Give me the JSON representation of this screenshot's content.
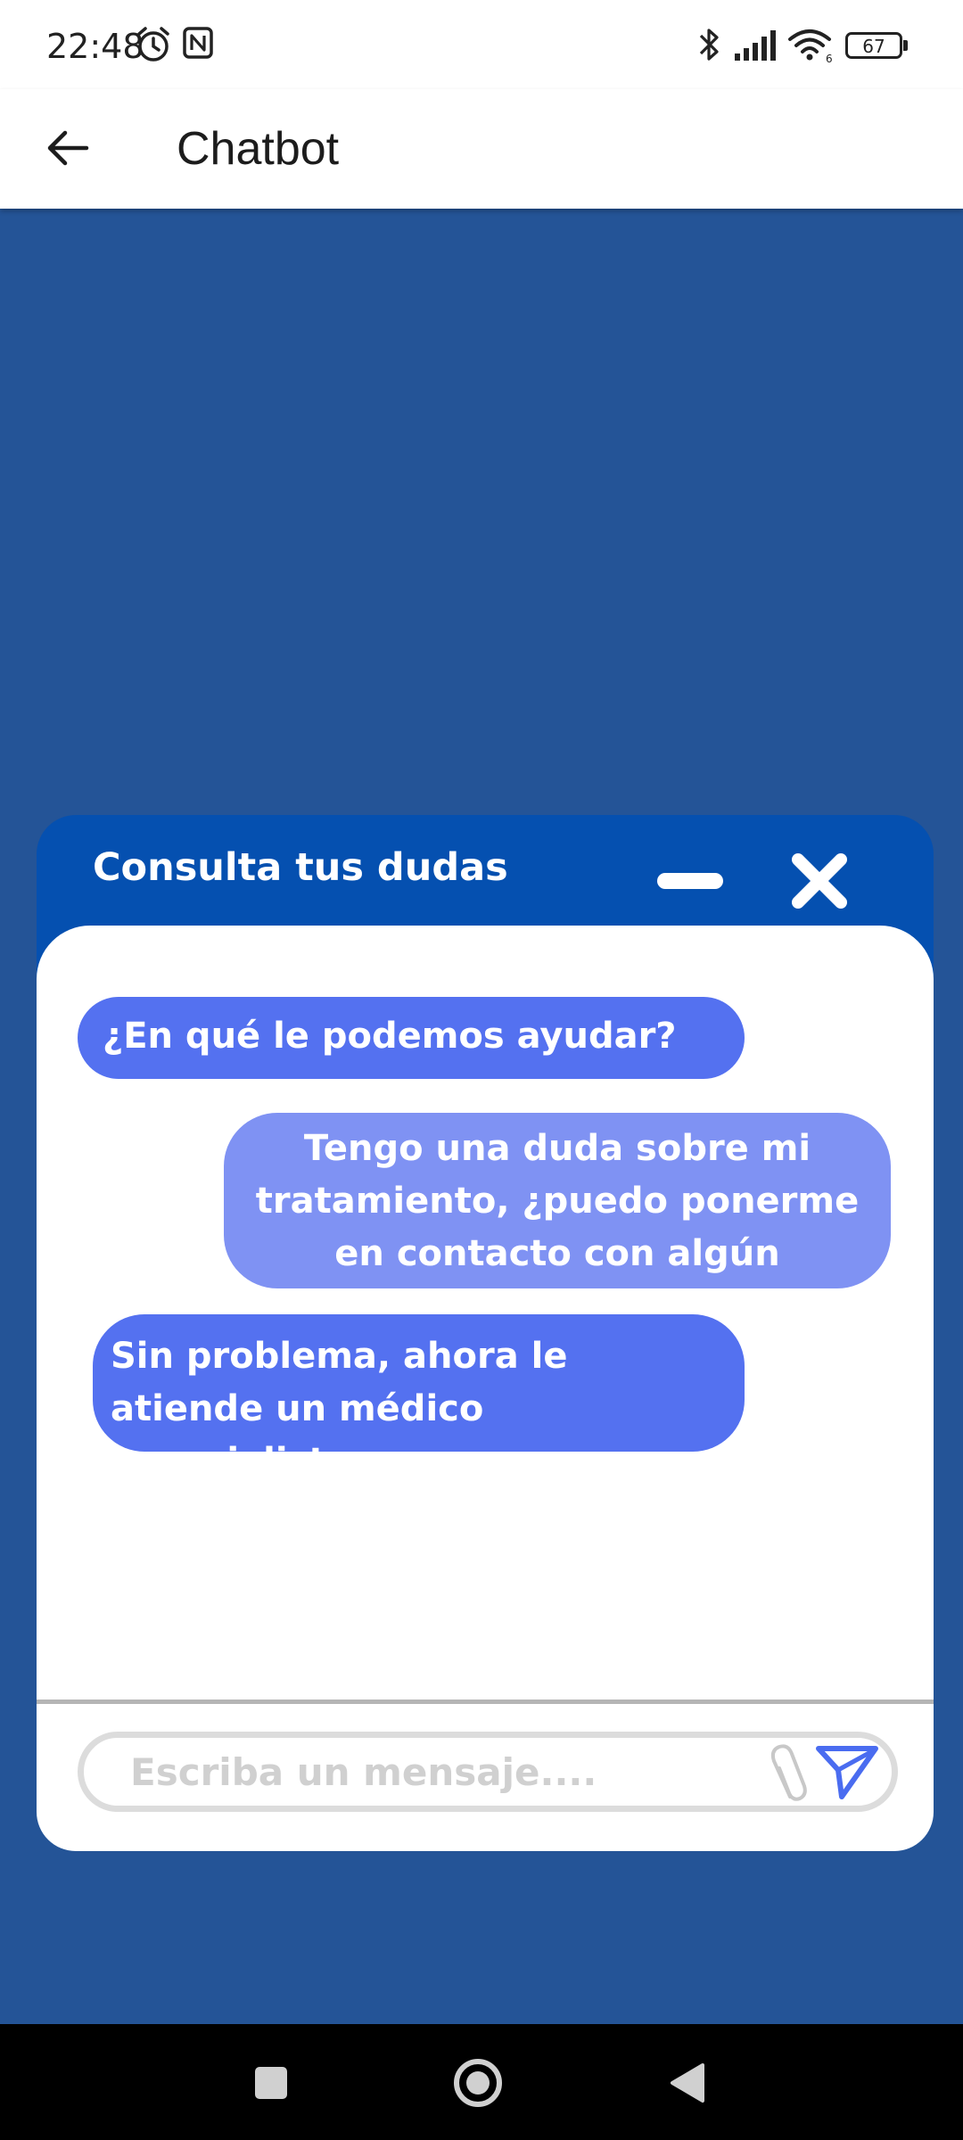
{
  "status_bar": {
    "time": "22:48",
    "battery_level": "67",
    "icons": [
      "alarm-icon",
      "nfc-icon",
      "bluetooth-icon",
      "signal-icon",
      "wifi-icon",
      "battery-icon"
    ]
  },
  "app_bar": {
    "title": "Chatbot",
    "back_icon": "arrow-left-icon"
  },
  "chat": {
    "header_title": "Consulta tus dudas",
    "minimize_icon": "minimize-icon",
    "close_icon": "close-icon",
    "messages": [
      {
        "sender": "bot",
        "text": "¿En qué le podemos ayudar?"
      },
      {
        "sender": "user",
        "text": "Tengo una duda sobre mi tratamiento, ¿puedo ponerme en contacto con algún profesional?"
      },
      {
        "sender": "bot",
        "text": "Sin problema, ahora le atiende un médico especialista."
      }
    ],
    "input": {
      "value": "",
      "placeholder": "Escriba un mensaje...."
    },
    "attach_icon": "paperclip-icon",
    "send_icon": "send-icon"
  },
  "nav_bar": {
    "icons": [
      "square-recents-icon",
      "circle-home-icon",
      "triangle-back-icon"
    ]
  },
  "colors": {
    "page_background": "#245497",
    "widget_header": "#0550b0",
    "bot_bubble": "#5471f0",
    "user_bubble": "#7f92f3",
    "send_icon": "#4a6cf0"
  }
}
